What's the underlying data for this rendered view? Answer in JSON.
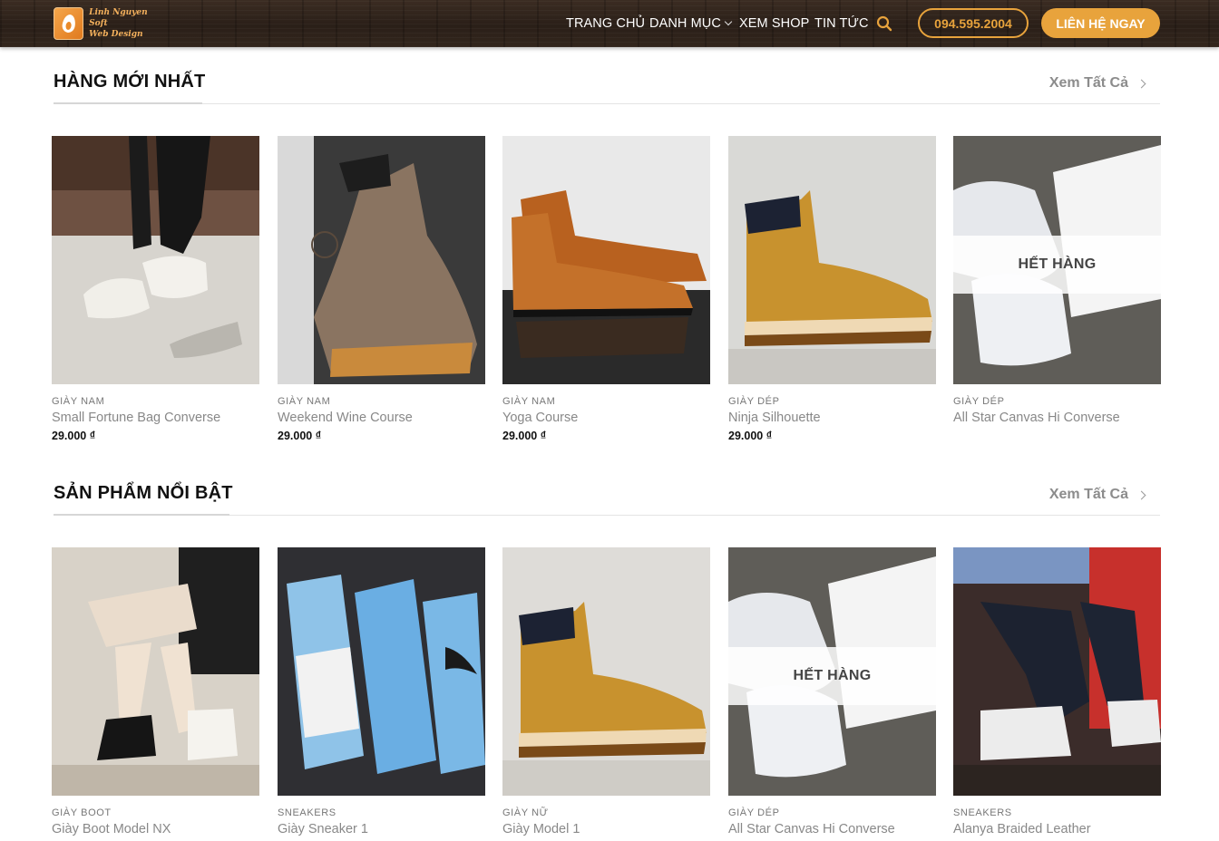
{
  "header": {
    "logo_line1": "Linh Nguyen Soft",
    "logo_line2": "Web Design",
    "nav": [
      {
        "label": "TRANG CHỦ"
      },
      {
        "label": "DANH MỤC"
      },
      {
        "label": "XEM SHOP"
      },
      {
        "label": "TIN TỨC"
      }
    ],
    "phone_label": "094.595.2004",
    "contact_label": "LIÊN HỆ NGAY",
    "search_icon": "search-icon"
  },
  "sections": [
    {
      "title": "HÀNG MỚI NHẤT",
      "view_all": "Xem Tất Cả",
      "products": [
        {
          "category": "GIÀY NAM",
          "name": "Small Fortune Bag Converse",
          "price": "29.000 ₫",
          "sold_out": ""
        },
        {
          "category": "GIÀY NAM",
          "name": "Weekend Wine Course",
          "price": "29.000 ₫",
          "sold_out": ""
        },
        {
          "category": "GIÀY NAM",
          "name": "Yoga Course",
          "price": "29.000 ₫",
          "sold_out": ""
        },
        {
          "category": "GIÀY DÉP",
          "name": "Ninja Silhouette",
          "price": "29.000 ₫",
          "sold_out": ""
        },
        {
          "category": "GIÀY DÉP",
          "name": "All Star Canvas Hi Converse",
          "price": "",
          "sold_out": "HẾT HÀNG"
        }
      ]
    },
    {
      "title": "SẢN PHẨM NỔI BẬT",
      "view_all": "Xem Tất Cả",
      "products": [
        {
          "category": "GIÀY BOOT",
          "name": "Giày Boot Model NX",
          "price": "",
          "sold_out": ""
        },
        {
          "category": "SNEAKERS",
          "name": "Giày Sneaker 1",
          "price": "",
          "sold_out": ""
        },
        {
          "category": "GIÀY NỮ",
          "name": "Giày Model 1",
          "price": "",
          "sold_out": ""
        },
        {
          "category": "GIÀY DÉP",
          "name": "All Star Canvas Hi Converse",
          "price": "",
          "sold_out": "HẾT HÀNG"
        },
        {
          "category": "SNEAKERS",
          "name": "Alanya Braided Leather",
          "price": "",
          "sold_out": ""
        }
      ]
    }
  ],
  "colors": {
    "accent": "#e8a33c",
    "header_bg": "#2f231b"
  }
}
